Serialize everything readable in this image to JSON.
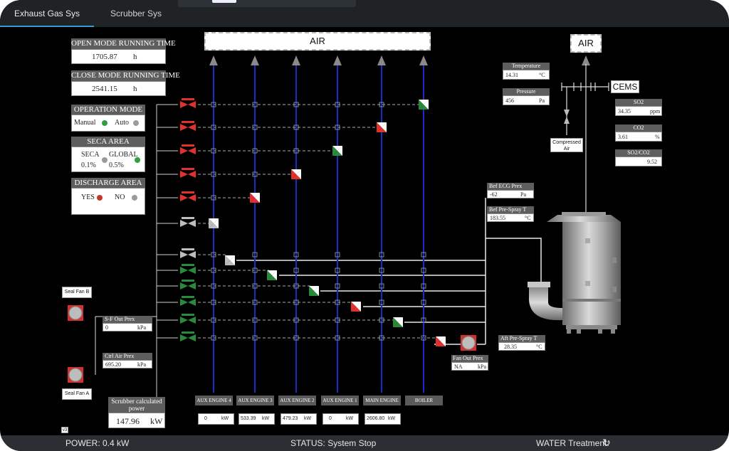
{
  "tabs": [
    {
      "label": "Exhaust Gas Sys",
      "active": true
    },
    {
      "label": "Scrubber Sys",
      "active": false
    }
  ],
  "running_time": {
    "open": {
      "label": "OPEN MODE RUNNING TIME",
      "value": "1705.87",
      "unit": "h"
    },
    "close": {
      "label": "CLOSE MODE RUNNING TIME",
      "value": "2541.15",
      "unit": "h"
    }
  },
  "operation_mode": {
    "label": "OPERATION MODE",
    "manual": "Manual",
    "auto": "Auto",
    "manual_color": "#2ea043",
    "auto_color": "#9a9a9a"
  },
  "seca_area": {
    "label": "SECA AREA",
    "seca": "SECA",
    "seca_pct": "0.1%",
    "global": "GLOBAL",
    "global_pct": "0.5%",
    "seca_color": "#9a9a9a",
    "global_color": "#2ea043"
  },
  "discharge_area": {
    "label": "DISCHARGE AREA",
    "yes": "YES",
    "no": "NO",
    "yes_color": "#c0392b",
    "no_color": "#9a9a9a"
  },
  "air_main": "AIR",
  "air_stack": "AIR",
  "cems": "CEMS",
  "temperature": {
    "label": "Temperature",
    "value": "14.31",
    "unit": "°C"
  },
  "pressure": {
    "label": "Pressure",
    "value": "456",
    "unit": "Pa"
  },
  "so2": {
    "label": "SO2",
    "value": "34.35",
    "unit": "ppm"
  },
  "co2": {
    "label": "CO2",
    "value": "3.61",
    "unit": "%"
  },
  "so2_co2": {
    "label": "SO2/CO2",
    "value": "9.52"
  },
  "compressed_air": "Compressed Air",
  "bef_ecg": {
    "label": "Bef ECG Prex",
    "value": "-62",
    "unit": "Pa"
  },
  "bef_prespray": {
    "label": "Bef Pre-Spray T",
    "value": "183.55",
    "unit": "°C"
  },
  "aft_prespray": {
    "label": "Aft Pre-Spray T",
    "value": "28.35",
    "unit": "°C"
  },
  "fan_out": {
    "label": "Fan Out Prex",
    "value": "NA",
    "unit": "kPa"
  },
  "seal_fan_b": "Seal Fan B",
  "seal_fan_a": "Seal Fan A",
  "sf_out": {
    "label": "S-F Out Prex",
    "value": "0",
    "unit": "kPa"
  },
  "ctrl_air": {
    "label": "Ctrl Air Prex",
    "value": "695.20",
    "unit": "kPa"
  },
  "scrubber_power": {
    "label": "Scrubber calculated power",
    "value": "147.96",
    "unit": "kW"
  },
  "version_tag": "v3",
  "engines": [
    {
      "name": "AUX ENGINE 4",
      "value": "0",
      "unit": "kW"
    },
    {
      "name": "AUX ENGINE 3",
      "value": "533.39",
      "unit": "kW"
    },
    {
      "name": "AUX ENGINE 2",
      "value": "479.23",
      "unit": "kW"
    },
    {
      "name": "AUX ENGINE 1",
      "value": "0",
      "unit": "kW"
    },
    {
      "name": "MAIN ENGINE",
      "value": "2606.80",
      "unit": "kW"
    },
    {
      "name": "BOILER",
      "value": "",
      "unit": ""
    }
  ],
  "colors": {
    "pipe_blue": "#1a2cc8",
    "valve_red": "#e0312f",
    "valve_green": "#2a8a3c",
    "valve_gray": "#bdbdbd",
    "status_bar": "#2b2f33"
  },
  "status": {
    "power": "POWER: 0.4 kW",
    "status": "STATUS: System Stop",
    "water": "WATER Treatment:"
  }
}
